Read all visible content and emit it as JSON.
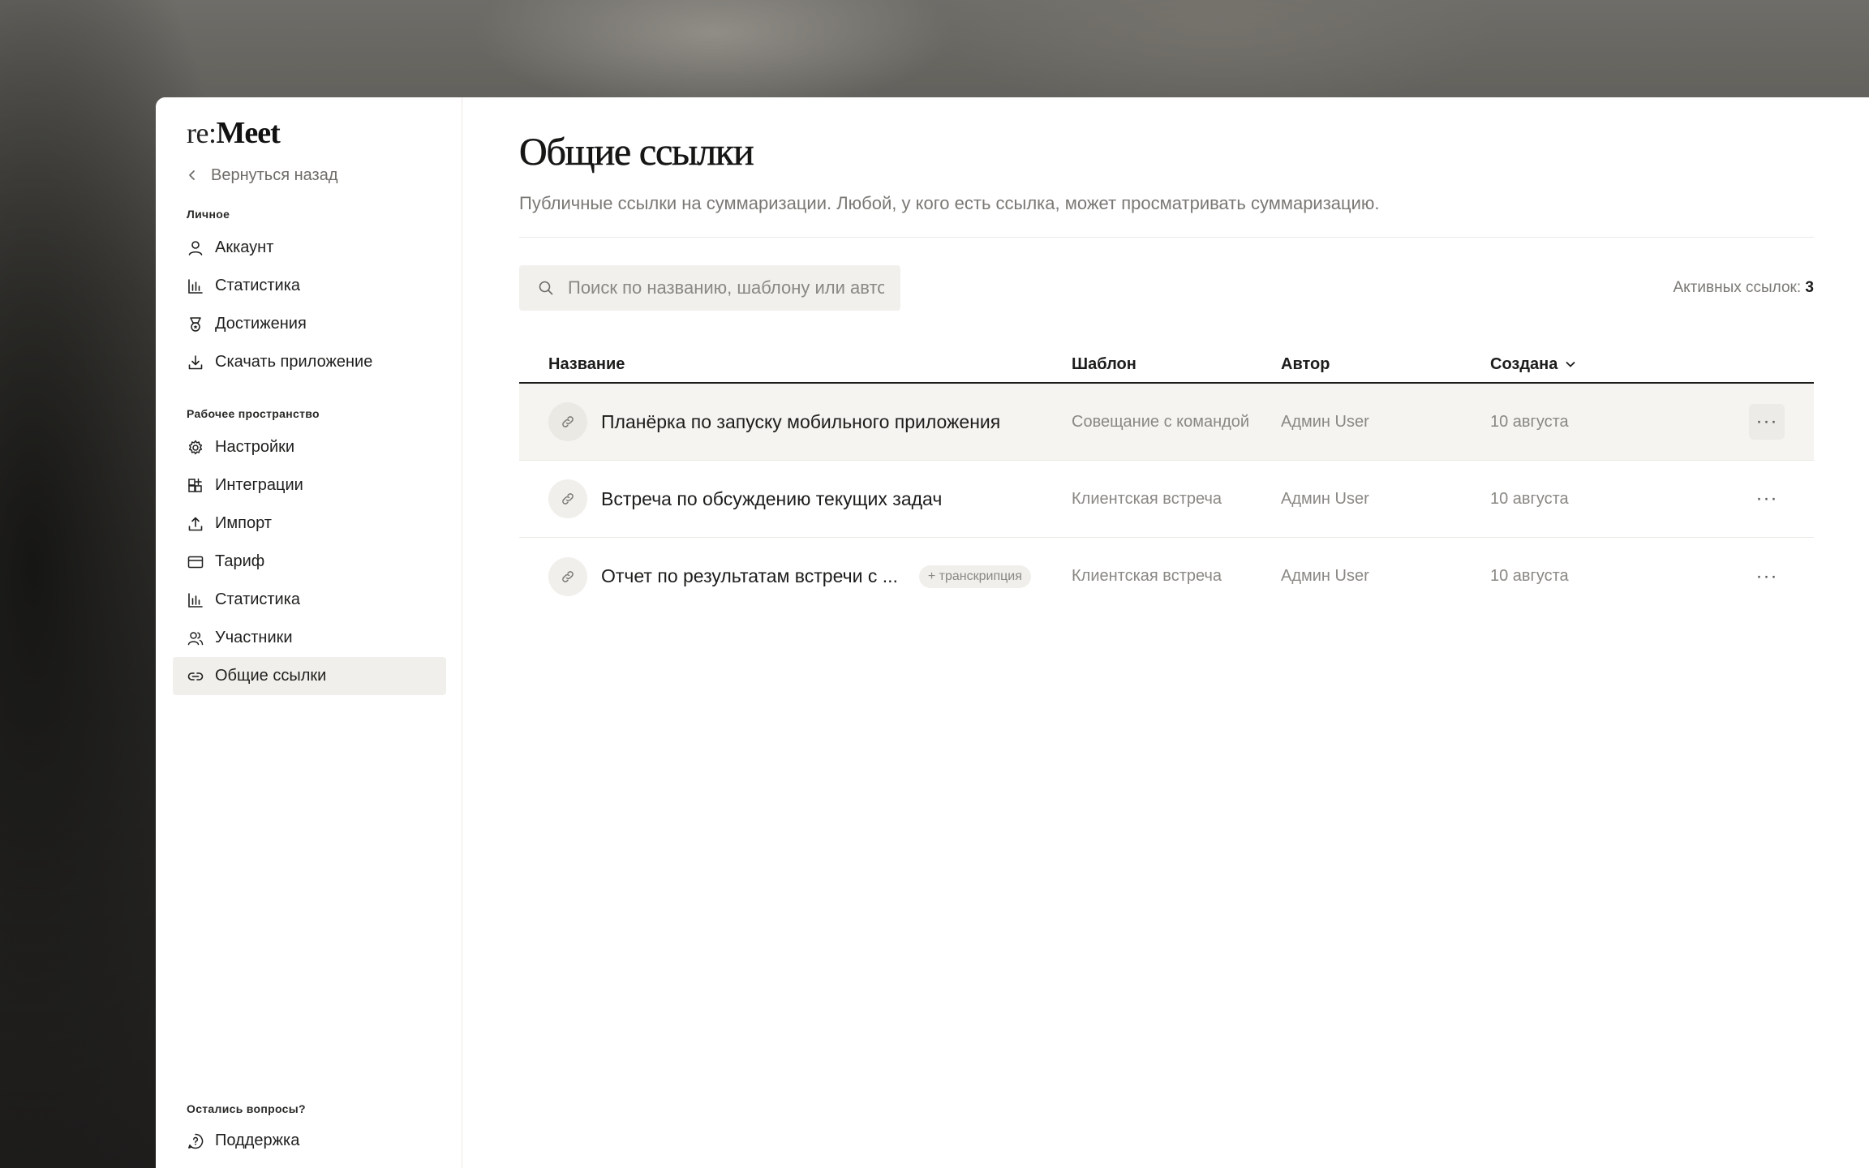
{
  "brand": {
    "prefix": "re:",
    "name": "Meet"
  },
  "sidebar": {
    "back_label": "Вернуться назад",
    "personal": {
      "label": "Личное",
      "items": [
        {
          "label": "Аккаунт",
          "icon": "user-icon"
        },
        {
          "label": "Статистика",
          "icon": "bar-chart-icon"
        },
        {
          "label": "Достижения",
          "icon": "medal-icon"
        },
        {
          "label": "Скачать приложение",
          "icon": "download-icon"
        }
      ]
    },
    "workspace": {
      "label": "Рабочее пространство",
      "items": [
        {
          "label": "Настройки",
          "icon": "gear-icon"
        },
        {
          "label": "Интеграции",
          "icon": "grid-plus-icon"
        },
        {
          "label": "Импорт",
          "icon": "upload-icon"
        },
        {
          "label": "Тариф",
          "icon": "credit-card-icon"
        },
        {
          "label": "Статистика",
          "icon": "bar-chart-icon"
        },
        {
          "label": "Участники",
          "icon": "users-icon"
        },
        {
          "label": "Общие ссылки",
          "icon": "link-icon",
          "active": true
        }
      ]
    },
    "footer": {
      "label": "Остались вопросы?",
      "support_label": "Поддержка"
    }
  },
  "main": {
    "title": "Общие ссылки",
    "subtitle": "Публичные ссылки на суммаризации. Любой, у кого есть ссылка, может просматривать суммаризацию.",
    "search": {
      "placeholder": "Поиск по названию, шаблону или автору"
    },
    "active_count": {
      "label": "Активных ссылок:",
      "value": "3"
    },
    "table": {
      "columns": {
        "name": "Название",
        "template": "Шаблон",
        "author": "Автор",
        "created": "Создана"
      },
      "rows": [
        {
          "name": "Планёрка по запуску мобильного приложения",
          "badge": "",
          "template": "Совещание с командой",
          "author": "Админ User",
          "created": "10 августа",
          "more": "···"
        },
        {
          "name": "Встреча по обсуждению текущих задач",
          "badge": "",
          "template": "Клиентская встреча",
          "author": "Админ User",
          "created": "10 августа",
          "more": "···"
        },
        {
          "name": "Отчет по результатам встречи с ...",
          "badge": "+ транскрипция",
          "template": "Клиентская встреча",
          "author": "Админ User",
          "created": "10 августа",
          "more": "···"
        }
      ]
    }
  },
  "colors": {
    "accent_text": "#1c1c1a",
    "muted_text": "#7a7874",
    "active_bg": "#f1efeb",
    "window_bg": "#ffffff"
  }
}
